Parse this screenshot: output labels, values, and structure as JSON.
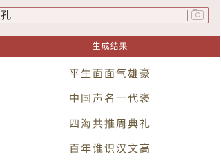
{
  "search": {
    "value": "孔"
  },
  "banner": {
    "title": "生成结果"
  },
  "results": {
    "lines": [
      "平生面面气雄豪",
      "中国声名一代褒",
      "四海共推周典礼",
      "百年谁识汉文高"
    ]
  },
  "icons": {
    "camera": "camera-icon"
  }
}
